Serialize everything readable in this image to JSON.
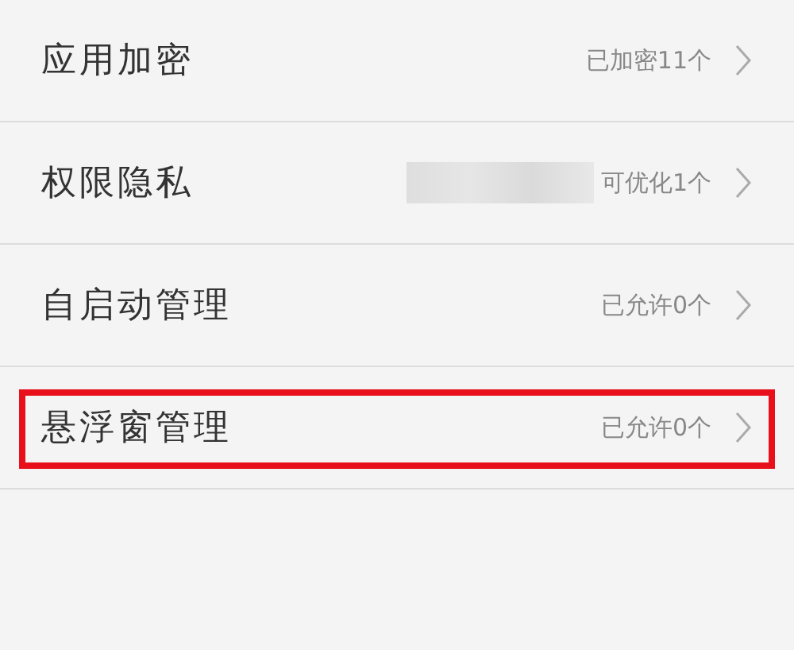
{
  "rows": [
    {
      "title": "应用加密",
      "status": "已加密11个",
      "redacted": false,
      "highlighted": false
    },
    {
      "title": "权限隐私",
      "status": "可优化1个",
      "redacted": true,
      "highlighted": false
    },
    {
      "title": "自启动管理",
      "status": "已允许0个",
      "redacted": false,
      "highlighted": false
    },
    {
      "title": "悬浮窗管理",
      "status": "已允许0个",
      "redacted": false,
      "highlighted": true
    }
  ]
}
